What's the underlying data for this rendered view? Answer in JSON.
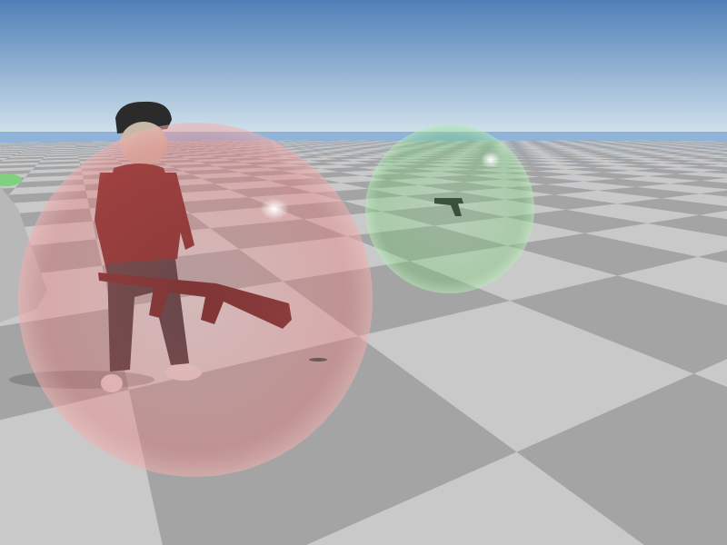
{
  "scene": {
    "sky_top_color": "#4f7fb8",
    "sky_horizon_color": "#c9dbe8",
    "tile_dark": "#a4a4a4",
    "tile_light": "#c9c9c9",
    "objects": [
      {
        "name": "player-character",
        "weapon": "assault-rifle",
        "zone_color": "#e07878"
      },
      {
        "name": "pickup-pistol",
        "zone_color": "#78d878"
      }
    ]
  }
}
